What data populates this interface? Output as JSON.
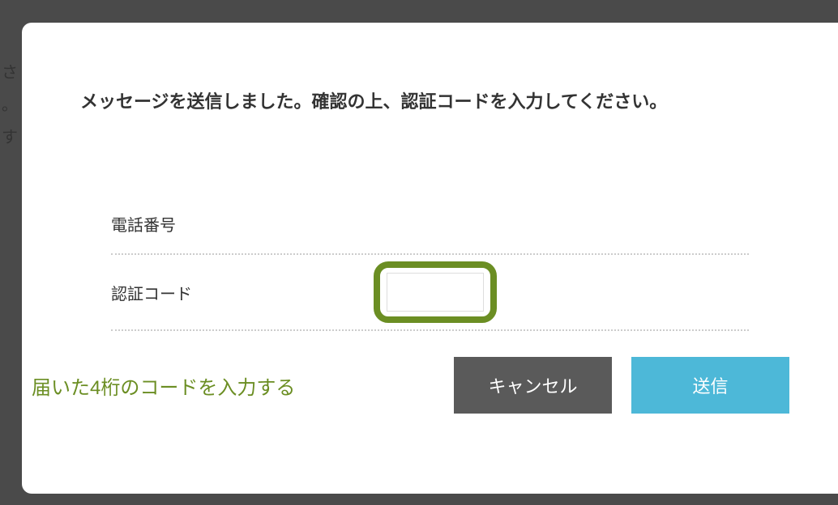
{
  "background": {
    "line1": "さ",
    "line2": "。",
    "line3": "す"
  },
  "modal": {
    "title": "メッセージを送信しました。確認の上、認証コードを入力してください。",
    "fields": {
      "phone": {
        "label": "電話番号",
        "value": ""
      },
      "code": {
        "label": "認証コード",
        "value": ""
      }
    },
    "helper_text": "届いた4桁のコードを入力する",
    "buttons": {
      "cancel": "キャンセル",
      "submit": "送信"
    }
  }
}
